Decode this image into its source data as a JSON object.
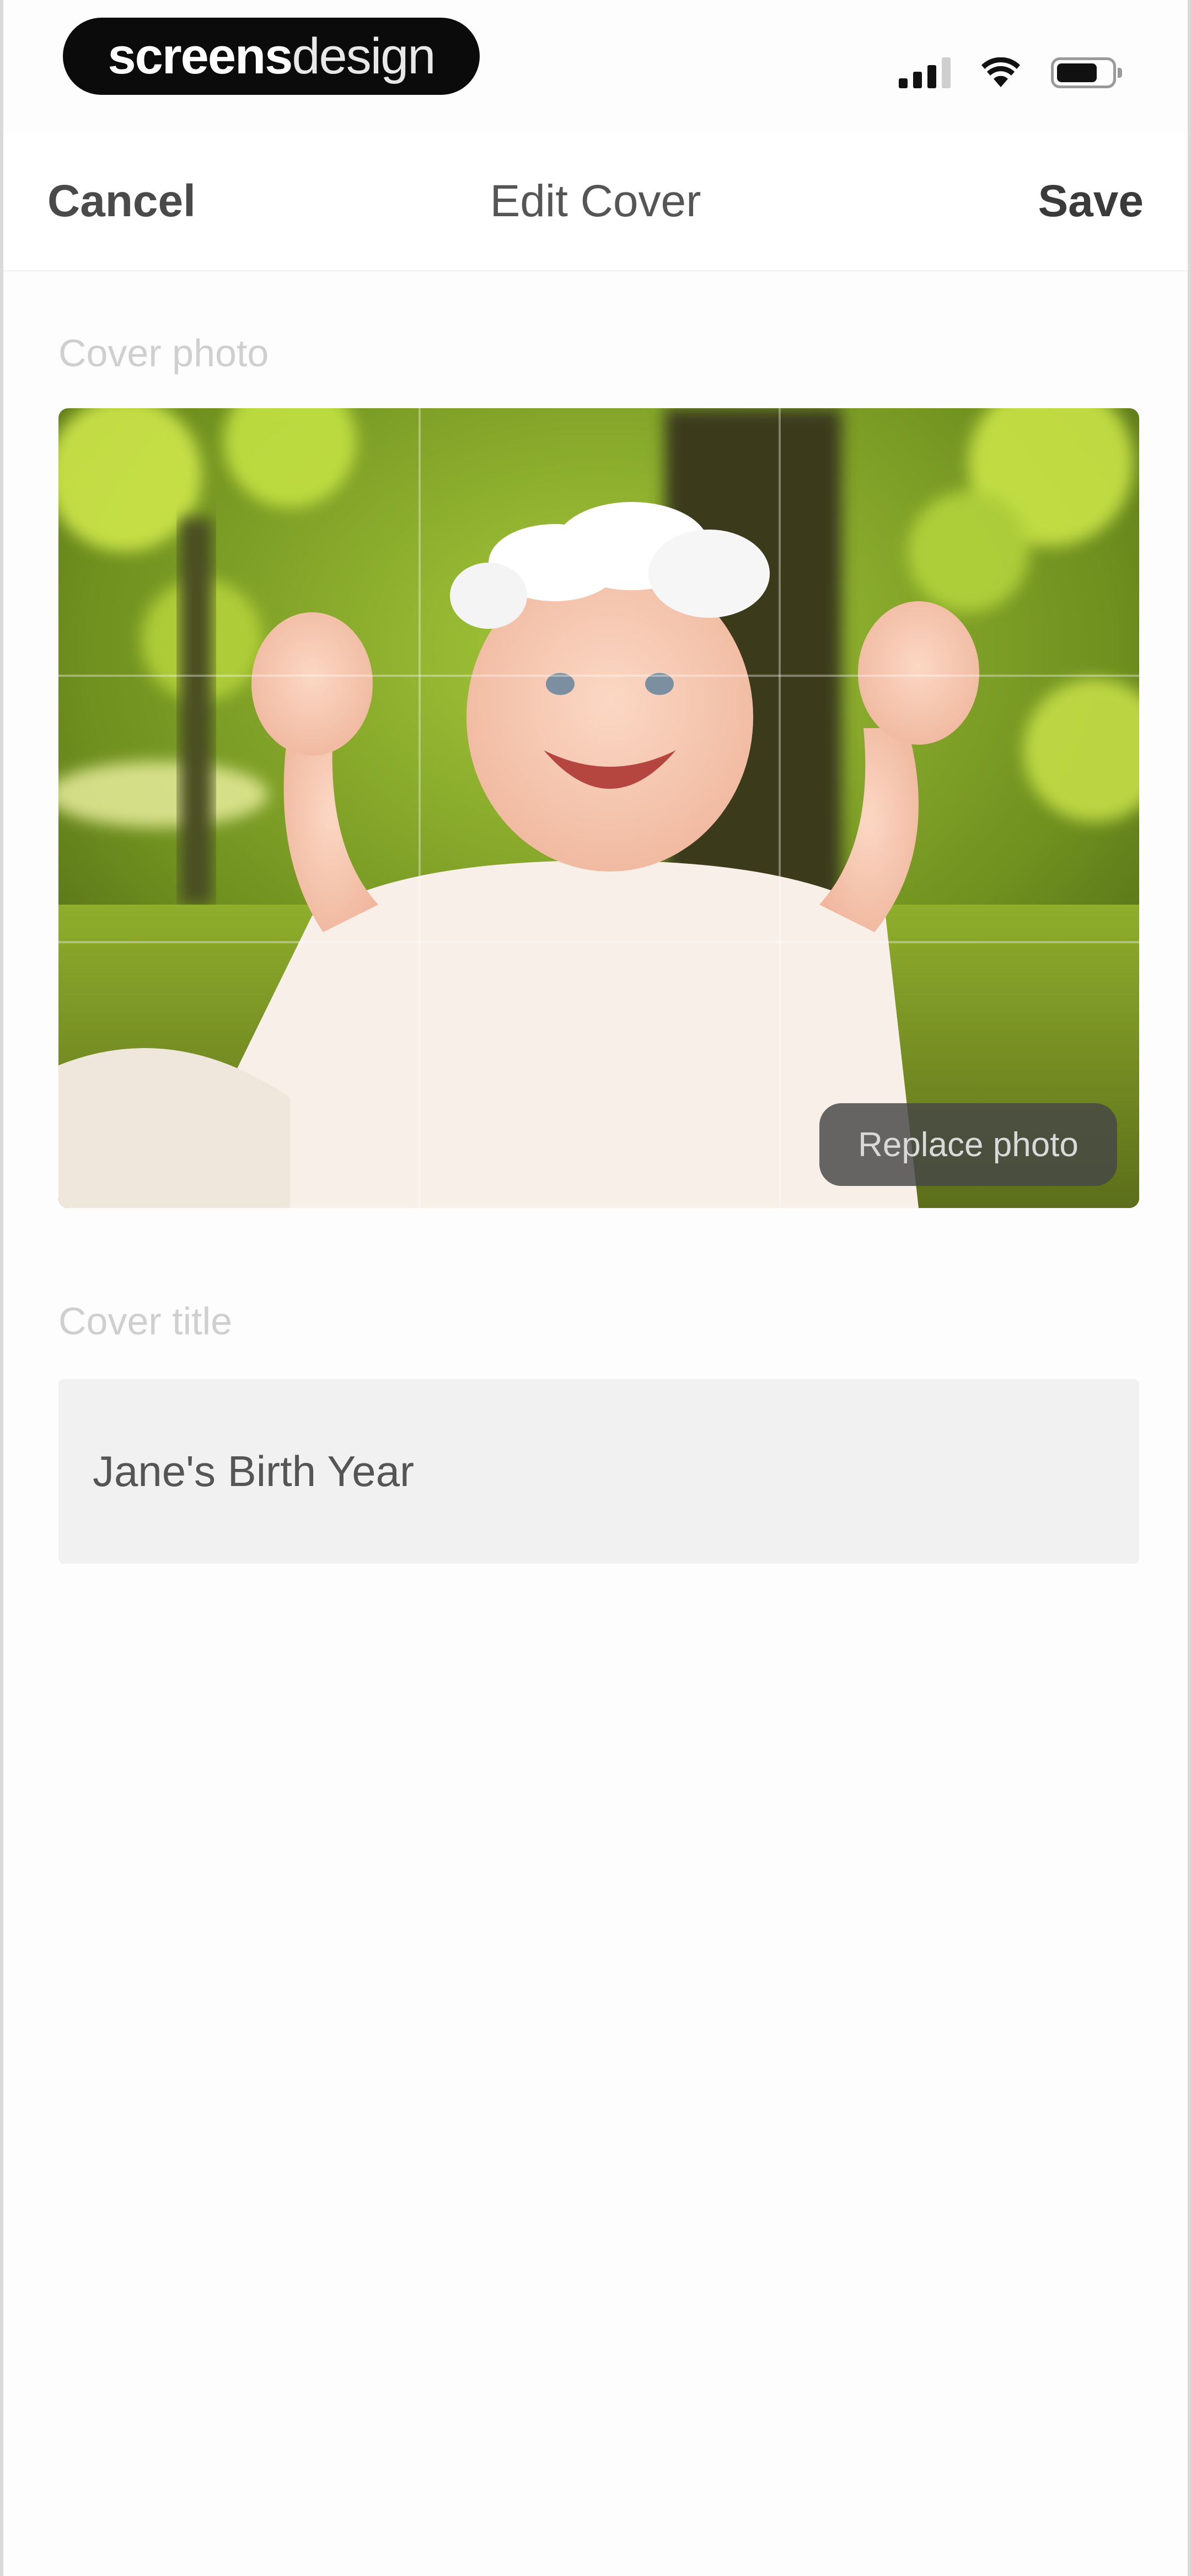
{
  "status_bar": {
    "brand_part1": "screens",
    "brand_part2": "design",
    "icons": [
      "signal-icon",
      "wifi-icon",
      "battery-icon"
    ]
  },
  "nav": {
    "cancel_label": "Cancel",
    "title": "Edit Cover",
    "save_label": "Save"
  },
  "cover": {
    "photo_label": "Cover photo",
    "replace_label": "Replace photo",
    "title_label": "Cover title",
    "title_value": "Jane's Birth Year"
  },
  "colors": {
    "background": "#fdfdfd",
    "field_background": "#f1f1f1",
    "label_color": "#cfcfcf",
    "text_dark": "#3a3a3a"
  }
}
